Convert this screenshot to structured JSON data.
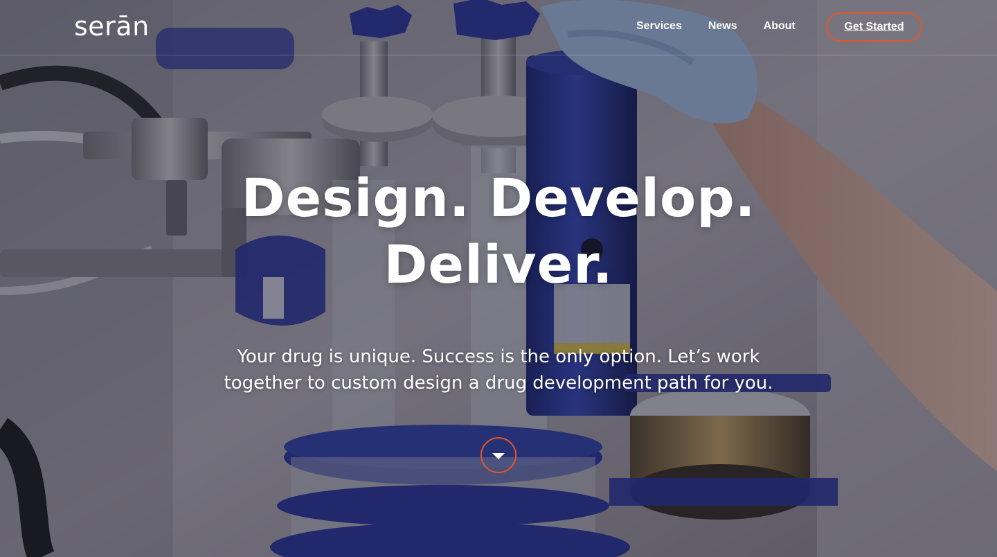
{
  "header": {
    "logo_text": "serān",
    "nav": [
      {
        "label": "Services"
      },
      {
        "label": "News"
      },
      {
        "label": "About"
      }
    ],
    "cta_label": "Get Started"
  },
  "hero": {
    "title_line1": "Design. Develop.",
    "title_line2": "Deliver.",
    "subtitle_line1": "Your drug is unique. Success is the only option.  Let’s work",
    "subtitle_line2": "together to custom design a drug development path for you.",
    "scroll_icon": "chevron-down-icon"
  },
  "colors": {
    "accent_orange": "#e0562a",
    "logo_accent_blue": "#2aa7e0",
    "equipment_blue": "#2f3fa0"
  }
}
